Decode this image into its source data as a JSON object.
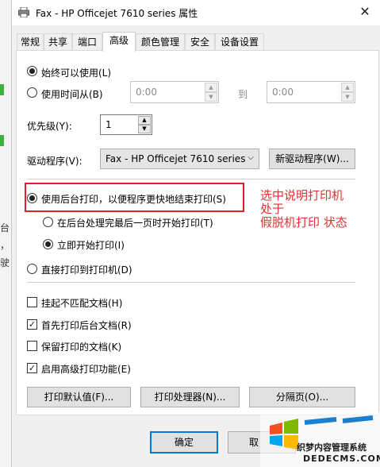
{
  "window": {
    "title": "Fax - HP Officejet 7610 series 属性",
    "close_glyph": "✕"
  },
  "tabs": [
    {
      "label": "常规"
    },
    {
      "label": "共享"
    },
    {
      "label": "端口"
    },
    {
      "label": "高级"
    },
    {
      "label": "颜色管理"
    },
    {
      "label": "安全"
    },
    {
      "label": "设备设置"
    }
  ],
  "active_tab": "高级",
  "availability": {
    "always_label": "始终可以使用(L)",
    "from_label": "使用时间从(B)",
    "from_time": "0:00",
    "to_label": "到",
    "to_time": "0:00"
  },
  "priority": {
    "label": "优先级(Y):",
    "value": "1"
  },
  "driver": {
    "label": "驱动程序(V):",
    "value": "Fax - HP Officejet 7610 series",
    "new_driver_button": "新驱动程序(W)..."
  },
  "spool": {
    "spool_label": "使用后台打印，以便程序更快地结束打印(S)",
    "start_after_last_label": "在后台处理完最后一页时开始打印(T)",
    "start_immediately_label": "立即开始打印(I)",
    "direct_label": "直接打印到打印机(D)"
  },
  "options": [
    {
      "label": "挂起不匹配文档(H)",
      "checked": false
    },
    {
      "label": "首先打印后台文档(R)",
      "checked": true
    },
    {
      "label": "保留打印的文档(K)",
      "checked": false
    },
    {
      "label": "启用高级打印功能(E)",
      "checked": true
    }
  ],
  "bottom_buttons": {
    "defaults": "打印默认值(F)...",
    "processor": "打印处理器(N)...",
    "separator_page": "分隔页(O)..."
  },
  "footer": {
    "ok": "确定",
    "cancel": "取"
  },
  "annotation": {
    "lines": [
      "选中说明打印机",
      "处于",
      "假脱机打印  状态"
    ]
  },
  "watermark": {
    "site": "织梦内容管理系统",
    "url": "DEDECMS.COM"
  },
  "background_fragments": {
    "chars": [
      "台",
      "，",
      "驶"
    ]
  },
  "colors": {
    "annotation_red": "#d9232a",
    "accent_blue": "#0078d7"
  }
}
